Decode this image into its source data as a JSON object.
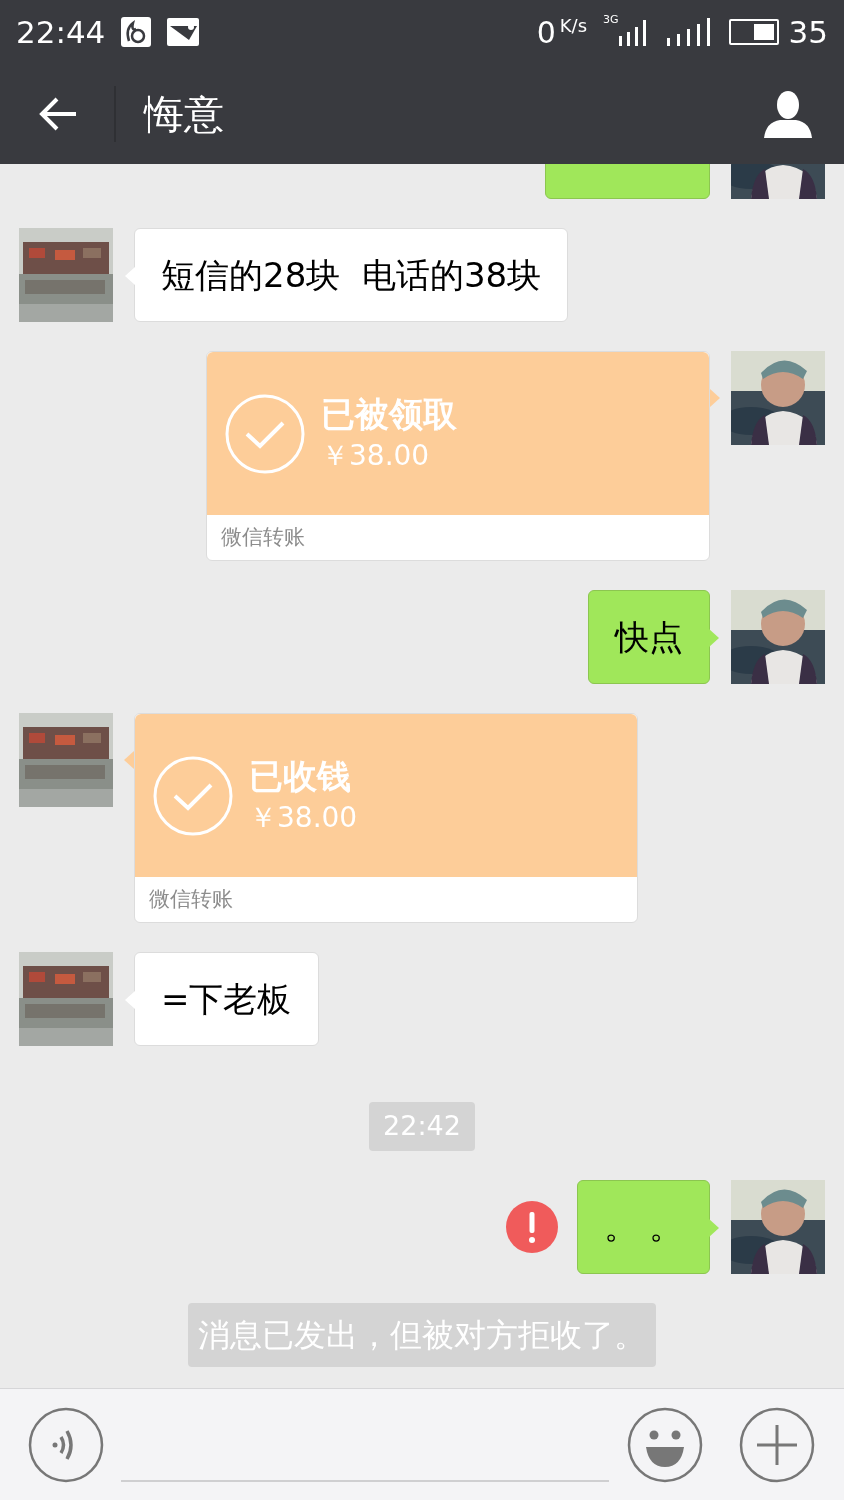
{
  "status_bar": {
    "time": "22:44",
    "speed": "0",
    "speed_unit": "K/s",
    "network": "3G",
    "battery": "35"
  },
  "header": {
    "title": "悔意"
  },
  "messages": [
    {
      "kind": "clipped",
      "outgoing": true
    },
    {
      "kind": "text",
      "outgoing": false,
      "text": "短信的28块  电话的38块"
    },
    {
      "kind": "transfer",
      "outgoing": true,
      "title": "已被领取",
      "amount": "￥38.00",
      "label": "微信转账"
    },
    {
      "kind": "text",
      "outgoing": true,
      "text": "快点",
      "failed": false
    },
    {
      "kind": "transfer",
      "outgoing": false,
      "title": "已收钱",
      "amount": "￥38.00",
      "label": "微信转账"
    },
    {
      "kind": "text",
      "outgoing": false,
      "text": "=下老板"
    },
    {
      "kind": "time",
      "text": "22:42"
    },
    {
      "kind": "text",
      "outgoing": true,
      "text": "。 。",
      "failed": true
    },
    {
      "kind": "system",
      "text": "消息已发出，但被对方拒收了。"
    }
  ]
}
